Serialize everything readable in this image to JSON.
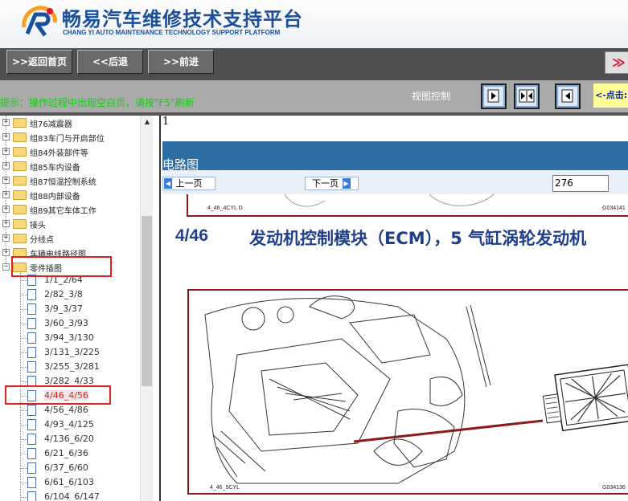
{
  "app": {
    "title_cn": "畅易汽车维修技术支持平台",
    "title_en": "CHANG YI AUTO MAINTENANCE TECHNOLOGY SUPPORT PLATFORM"
  },
  "toolbar": {
    "home_label": ">>返回首页",
    "back_label": "<<后退",
    "forward_label": ">>前进",
    "right_label": "≫"
  },
  "infobar": {
    "hint": "提示：操作过程中出现空白页，请按\"F5\"刷新",
    "view_control": "视图控制",
    "click_hint": "<-点击:"
  },
  "tree": {
    "folders": [
      {
        "label": "组76减震器"
      },
      {
        "label": "组83车门与开启部位"
      },
      {
        "label": "组84外装部件等"
      },
      {
        "label": "组85车内设备"
      },
      {
        "label": "组87恒温控制系统"
      },
      {
        "label": "组88内部设备"
      },
      {
        "label": "组89其它车体工作"
      },
      {
        "label": "接头"
      },
      {
        "label": "分线点"
      },
      {
        "label": "车辆电线路径图"
      },
      {
        "label": "零件插图"
      }
    ],
    "leaves": [
      {
        "label": "1/1_2/64"
      },
      {
        "label": "2/82_3/8"
      },
      {
        "label": "3/9_3/37"
      },
      {
        "label": "3/60_3/93"
      },
      {
        "label": "3/94_3/130"
      },
      {
        "label": "3/131_3/225"
      },
      {
        "label": "3/255_3/281"
      },
      {
        "label": "3/282_4/33"
      },
      {
        "label": "4/46_4/56"
      },
      {
        "label": "4/56_4/86"
      },
      {
        "label": "4/93_4/125"
      },
      {
        "label": "4/136_6/20"
      },
      {
        "label": "6/21_6/36"
      },
      {
        "label": "6/37_6/60"
      },
      {
        "label": "6/61_6/103"
      },
      {
        "label": "6/104_6/147"
      }
    ]
  },
  "main": {
    "page_index": "1",
    "section_title": "电路图",
    "prev_page": "上一页",
    "next_page": "下一页",
    "page_value": "276"
  },
  "document": {
    "prev_caption": "4_46_4CYL D",
    "prev_code": "G034141",
    "figure_number": "4/46",
    "figure_title": "发动机控制模块（ECM），5 气缸涡轮发动机",
    "figure_caption": "4_46_5CYL",
    "figure_code": "G034136"
  },
  "colors": {
    "brand_blue": "#1a4f9c",
    "hint_green": "#12d012",
    "highlight_red": "#e02020",
    "frame_red": "#8b1a1a",
    "section_bar": "#2e6da4"
  }
}
